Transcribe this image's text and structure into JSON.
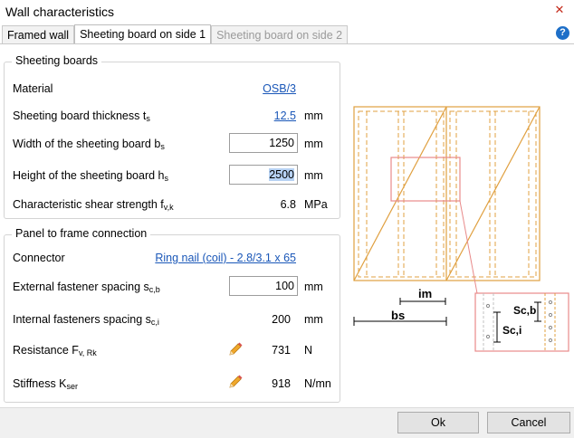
{
  "window": {
    "title": "Wall characteristics",
    "close_glyph": "✕"
  },
  "tabs": [
    {
      "label": "Framed wall",
      "state": "normal"
    },
    {
      "label": "Sheeting board on side 1",
      "state": "active"
    },
    {
      "label": "Sheeting board on side 2",
      "state": "disabled"
    }
  ],
  "help_glyph": "?",
  "sheeting": {
    "title": "Sheeting boards",
    "material": {
      "label": "Material",
      "value": "OSB/3"
    },
    "thickness": {
      "label": "Sheeting board thickness t",
      "sub": "s",
      "value": "12.5",
      "unit": "mm"
    },
    "width": {
      "label": "Width of the sheeting board b",
      "sub": "s",
      "value": "1250",
      "unit": "mm"
    },
    "height": {
      "label": "Height of the sheeting board h",
      "sub": "s",
      "value": "2500",
      "unit": "mm"
    },
    "shear": {
      "label": "Characteristic shear strength f",
      "sub": "v,k",
      "value": "6.8",
      "unit": "MPa"
    }
  },
  "connection": {
    "title": "Panel to frame connection",
    "connector": {
      "label": "Connector",
      "value": "Ring nail (coil) - 2.8/3.1 x 65"
    },
    "external": {
      "label": "External fastener spacing s",
      "sub": "c,b",
      "value": "100",
      "unit": "mm"
    },
    "internal": {
      "label": "Internal fasteners spacing s",
      "sub": "c,i",
      "value": "200",
      "unit": "mm"
    },
    "resistance": {
      "label": "Resistance F",
      "sub": "v, Rk",
      "value": "731",
      "unit": "N"
    },
    "stiffness": {
      "label": "Stiffness K",
      "sub": "ser",
      "value": "918",
      "unit": "N/mn"
    }
  },
  "diagram_labels": {
    "im": "im",
    "bs": "bs",
    "scb": "Sc,b",
    "sci": "Sc,i"
  },
  "buttons": {
    "ok": "Ok",
    "cancel": "Cancel"
  },
  "colors": {
    "accent": "#1a57b8",
    "board": "#e0a040",
    "detail": "#e88a8a"
  }
}
